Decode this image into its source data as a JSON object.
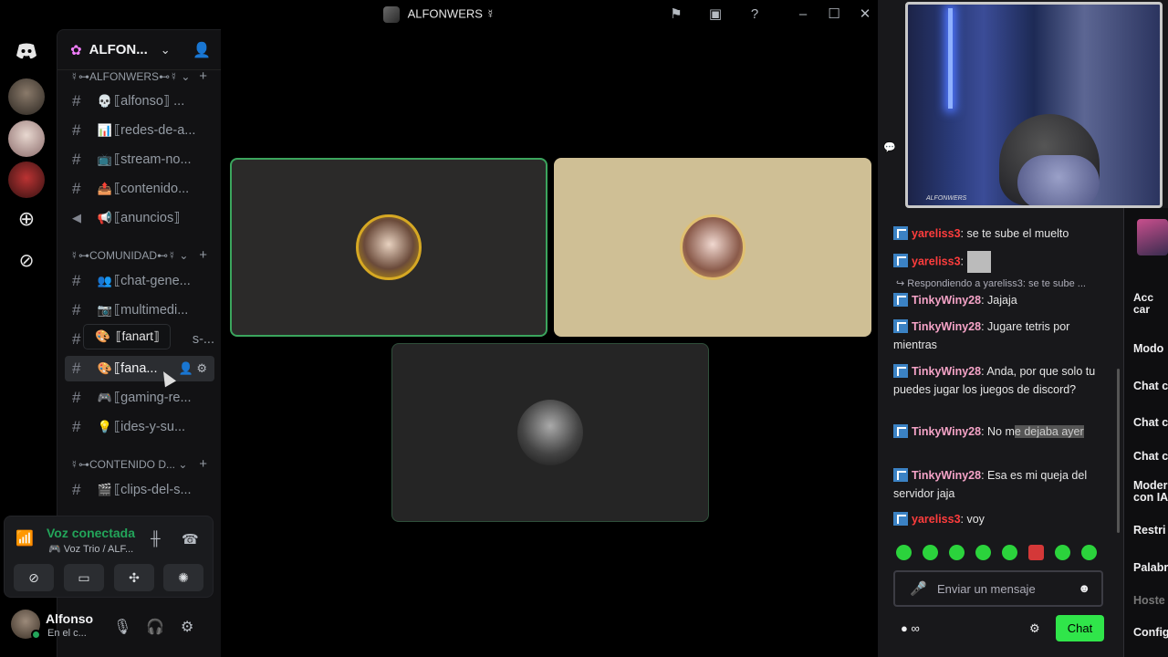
{
  "window": {
    "title": "ALFONWERS ☿"
  },
  "server": {
    "name": "ALFON..."
  },
  "categories": [
    {
      "label": "☿⊶ALFONWERS⊷☿ ⌄"
    },
    {
      "label": "☿⊶COMUNIDAD⊷☿ ⌄"
    },
    {
      "label": "☿⊶CONTENIDO D... ⌄"
    }
  ],
  "channels": [
    {
      "emoji": "💀",
      "label": "⟦alfonso⟧ ..."
    },
    {
      "emoji": "📊",
      "label": "⟦redes-de-a..."
    },
    {
      "emoji": "📺",
      "label": "⟦stream-no..."
    },
    {
      "emoji": "📤",
      "label": "⟦contenido..."
    },
    {
      "emoji": "📢",
      "label": "⟦anuncios⟧"
    },
    {
      "emoji": "👥",
      "label": "⟦chat-gene..."
    },
    {
      "emoji": "📷",
      "label": "⟦multimedi..."
    },
    {
      "emoji": "",
      "label": "s-..."
    },
    {
      "emoji": "🎨",
      "label": "⟦fana..."
    },
    {
      "emoji": "🎮",
      "label": "⟦gaming-re..."
    },
    {
      "emoji": "💡",
      "label": "⟦ides-y-su..."
    },
    {
      "emoji": "🎬",
      "label": "⟦clips-del-s..."
    }
  ],
  "tooltip": {
    "emoji": "🎨",
    "label": "⟦fanart⟧"
  },
  "voice": {
    "title": "Voz conectada",
    "subtitle": "🎮 Voz Trio / ALF..."
  },
  "user": {
    "name": "Alfonso",
    "status": "En el c..."
  },
  "colors": {
    "accent_green": "#23a55a",
    "twitch_green": "#30e54a",
    "tile_beige": "#cfbf95"
  },
  "chat": {
    "messages": [
      {
        "user": "yareliss3",
        "text": ": se te sube el muelto"
      },
      {
        "user": "yareliss3",
        "text": ":"
      },
      {
        "user": "TinkyWiny28",
        "text": ": Jajaja"
      },
      {
        "user": "TinkyWiny28",
        "text": ": Jugare tetris por mientras"
      },
      {
        "user": "TinkyWiny28",
        "text": ": Anda, por que solo tu puedes jugar los juegos de discord?"
      },
      {
        "user": "TinkyWiny28",
        "text": ": No m",
        "highlight": "e dejaba ayer"
      },
      {
        "user": "TinkyWiny28",
        "text": ": Esa es mi queja del servidor jaja"
      },
      {
        "user": "yareliss3",
        "text": ": voy"
      }
    ],
    "reply": "↪ Respondiendo a yareliss3: se te sube ...",
    "input_placeholder": "Enviar un mensaje",
    "points": "● ∞",
    "send_label": "Chat"
  },
  "side": {
    "items": [
      "Acc car",
      "Modo",
      "Chat c",
      "Chat c",
      "Chat c",
      "Moder con IA",
      "Restri",
      "Palabr",
      "Hoste",
      "Config"
    ]
  },
  "webcam": {
    "tag": "ALFONWERS"
  }
}
